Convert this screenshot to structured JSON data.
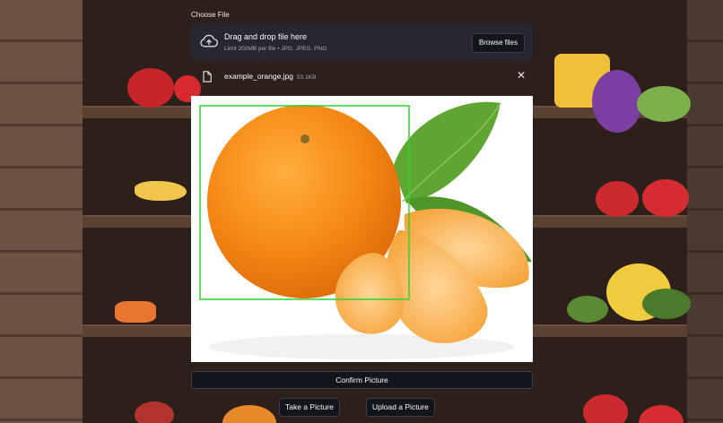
{
  "uploader": {
    "section_label": "Choose File",
    "drag_title": "Drag and drop file here",
    "drag_subtitle": "Limit 200MB per file • JPG, JPEG, PNG",
    "browse_label": "Browse files",
    "upload_icon": "cloud-upload-icon"
  },
  "file": {
    "name": "example_orange.jpg",
    "size": "53.1KB",
    "file_icon": "file-icon",
    "remove_icon": "close-icon",
    "remove_glyph": "✕"
  },
  "preview": {
    "subject": "orange with peeled segments and leaves",
    "detection_box_color": "#2fd22f"
  },
  "actions": {
    "confirm_label": "Confirm Picture",
    "take_label": "Take a Picture",
    "upload_label": "Upload a Picture"
  },
  "theme": {
    "panel": "#262730",
    "button": "#13151c",
    "text": "#fafafa",
    "muted": "#a3a8b8"
  }
}
